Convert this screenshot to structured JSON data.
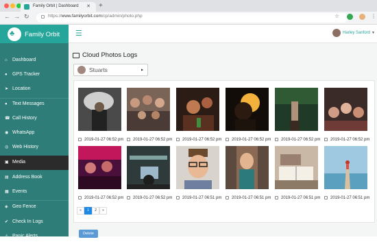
{
  "browser": {
    "tab_title": "Family Orbit | Dashboard",
    "new_tab": "+",
    "url_scheme": "https://",
    "url_host": "www.familyorbit.com",
    "url_path": "/cp/admin/photo.php"
  },
  "app": {
    "brand": "Family Orbit",
    "brand_color": "#26a69a",
    "user_name": "Harley Sanford"
  },
  "sidebar": {
    "items": [
      {
        "label": "Dashboard",
        "icon": "home-icon"
      },
      {
        "label": "GPS Tracker",
        "icon": "map-marker-icon"
      },
      {
        "label": "Location",
        "icon": "location-arrow-icon"
      },
      {
        "label": "Text Messages",
        "icon": "chat-icon"
      },
      {
        "label": "Call History",
        "icon": "phone-icon"
      },
      {
        "label": "WhatsApp",
        "icon": "whatsapp-icon"
      },
      {
        "label": "Web History",
        "icon": "globe-icon"
      },
      {
        "label": "Media",
        "icon": "image-icon"
      },
      {
        "label": "Address Book",
        "icon": "book-icon"
      },
      {
        "label": "Events",
        "icon": "calendar-icon"
      },
      {
        "label": "Geo Fence",
        "icon": "fence-icon"
      },
      {
        "label": "Check In Logs",
        "icon": "check-circle-icon"
      },
      {
        "label": "Panic Alerts",
        "icon": "alert-icon"
      }
    ],
    "active_index": 7
  },
  "page": {
    "title": "Cloud Photos Logs",
    "child_select": "Stuarts",
    "photos": [
      {
        "date": "2019-01-27 06:52 pm"
      },
      {
        "date": "2019-01-27 06:52 pm"
      },
      {
        "date": "2019-01-27 06:52 pm"
      },
      {
        "date": "2019-01-27 06:52 pm"
      },
      {
        "date": "2019-01-27 06:52 pm"
      },
      {
        "date": "2019-01-27 06:52 pm"
      },
      {
        "date": "2019-01-27 06:52 pm"
      },
      {
        "date": "2019-01-27 06:52 pm"
      },
      {
        "date": "2019-01-27 06:51 pm"
      },
      {
        "date": "2019-01-27 06:51 pm"
      },
      {
        "date": "2019-01-27 06:51 pm"
      },
      {
        "date": "2019-01-27 06:51 pm"
      }
    ],
    "pagination": [
      "«",
      "1",
      "2",
      "»"
    ],
    "current_page": "1",
    "delete_label": "Delete"
  }
}
